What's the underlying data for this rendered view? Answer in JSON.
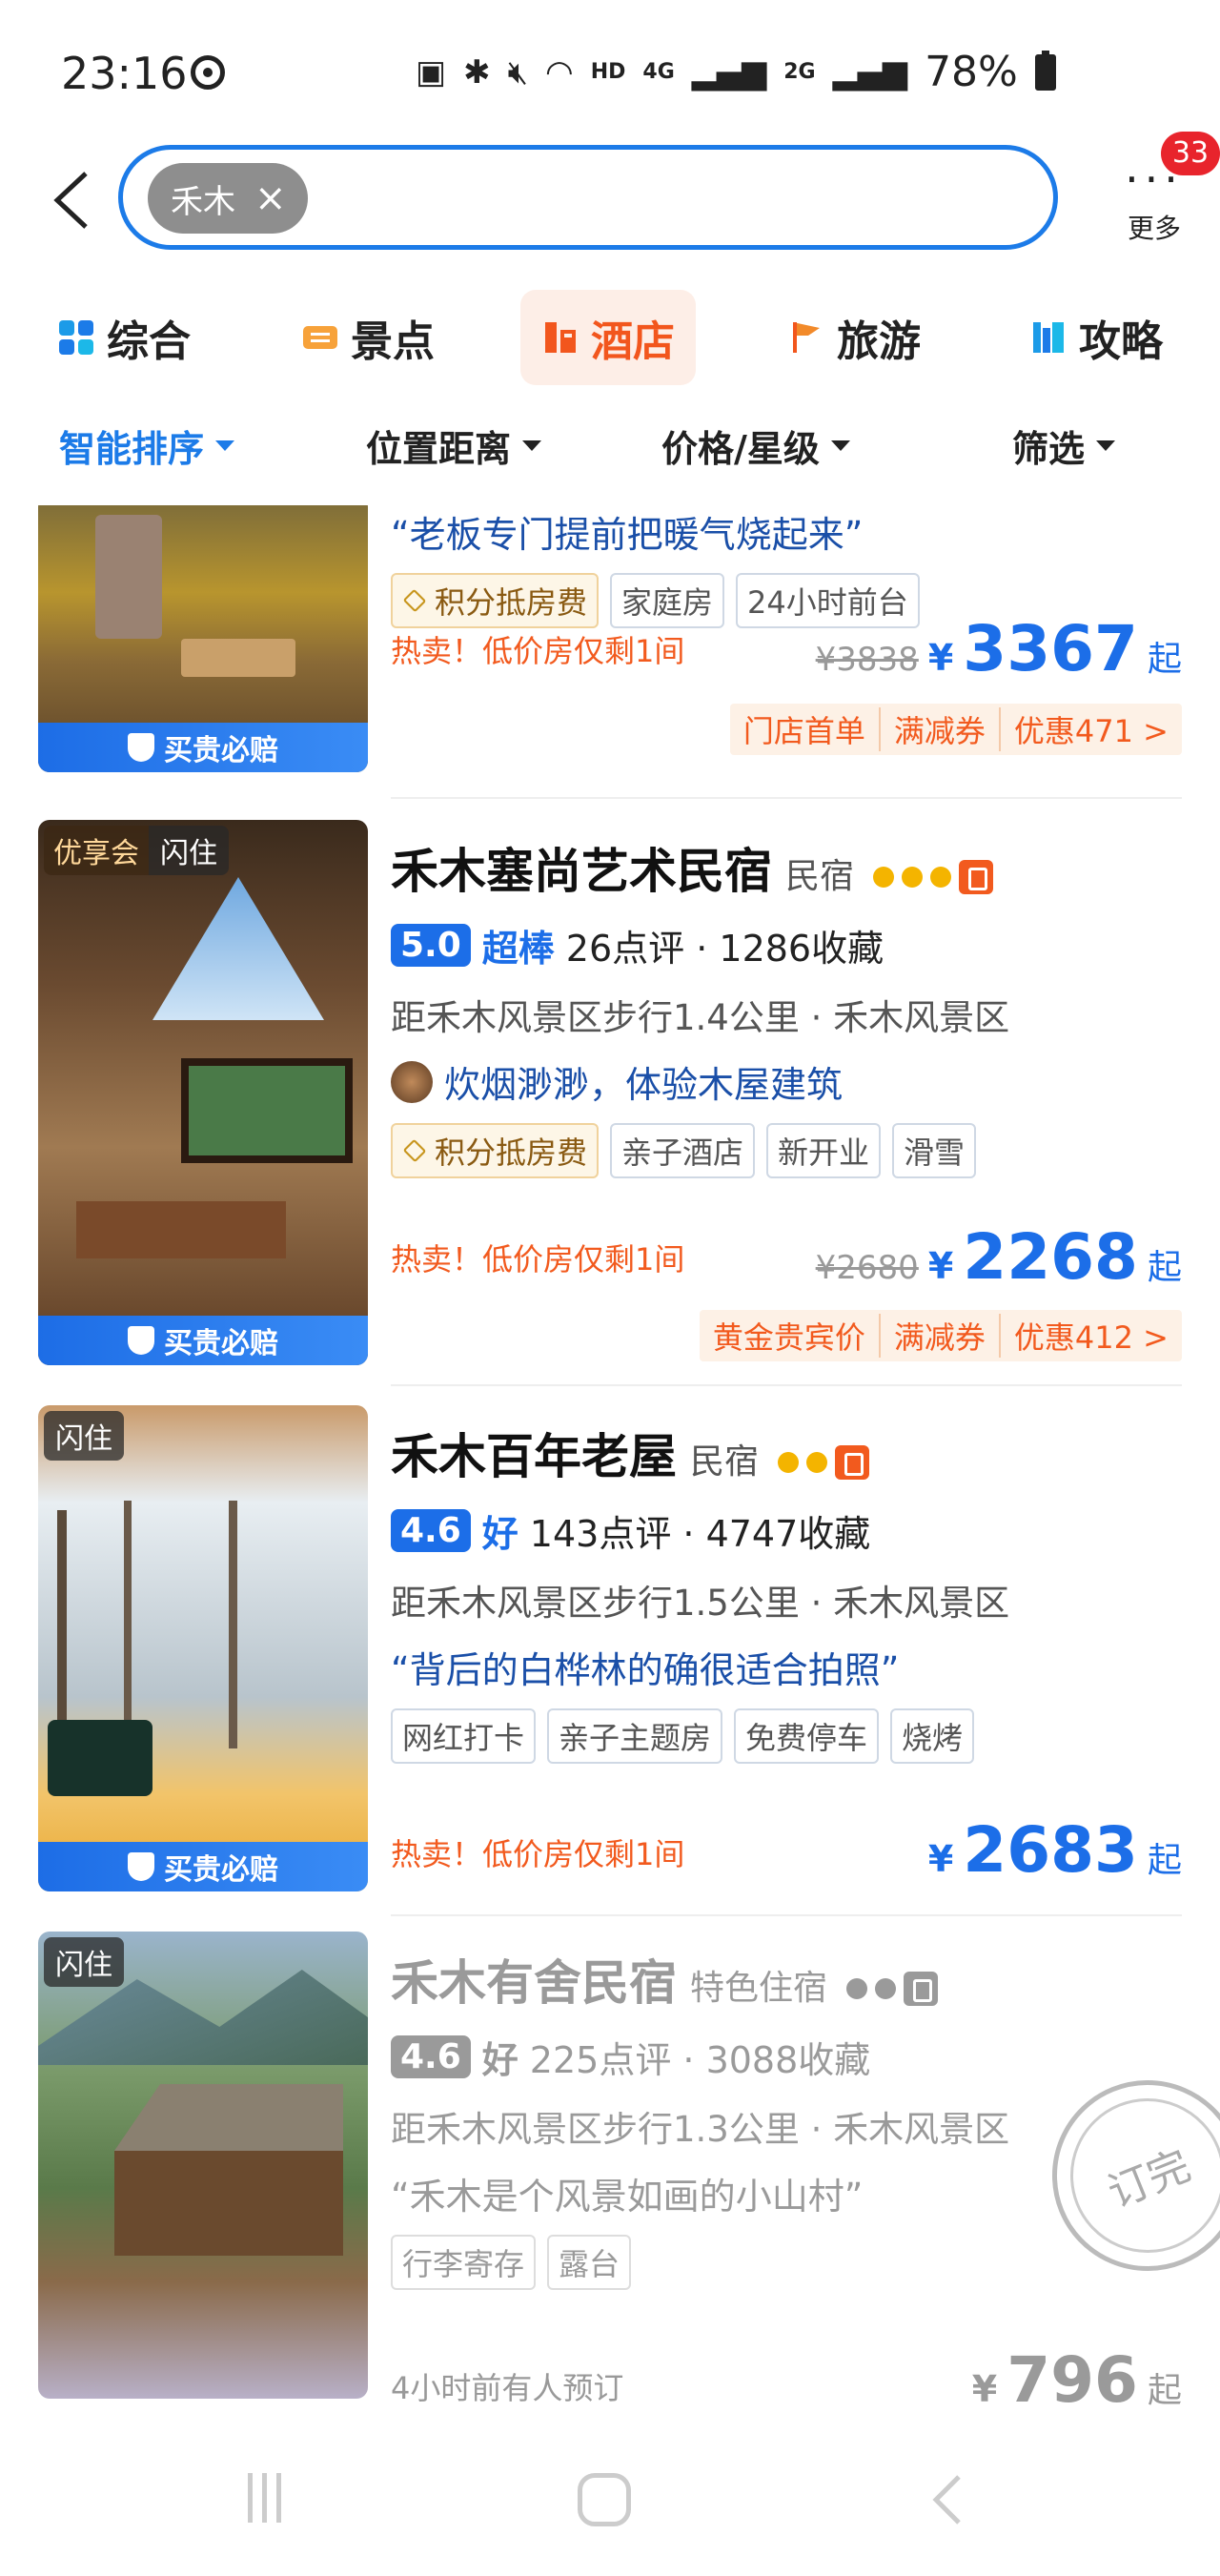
{
  "status_bar": {
    "time": "23:16",
    "net_hd": "HD",
    "net_4g": "4G",
    "net_2g": "2G",
    "battery": "78%",
    "icons": [
      "sync-icon",
      "battery-saver-icon",
      "bluetooth-icon",
      "mute-icon",
      "wifi-icon",
      "signal-icon",
      "battery-icon"
    ]
  },
  "search": {
    "chip_label": "禾木",
    "chip_close": "×",
    "more_label": "更多",
    "more_dots": "···",
    "badge_count": "33"
  },
  "category_tabs": [
    {
      "label": "综合",
      "icon": "grid-icon",
      "active": false
    },
    {
      "label": "景点",
      "icon": "ticket-icon",
      "active": false
    },
    {
      "label": "酒店",
      "icon": "hotel-icon",
      "active": true
    },
    {
      "label": "旅游",
      "icon": "flag-icon",
      "active": false
    },
    {
      "label": "攻略",
      "icon": "book-icon",
      "active": false
    }
  ],
  "sort_bar": [
    {
      "label": "智能排序",
      "active": true
    },
    {
      "label": "位置距离",
      "active": false
    },
    {
      "label": "价格/星级",
      "active": false
    },
    {
      "label": "筛选",
      "active": false
    }
  ],
  "listings": [
    {
      "quote": "“老板专门提前把暖气烧起来”",
      "tags": [
        "积分抵房费",
        "家庭房",
        "24小时前台"
      ],
      "hot_text": "热卖！低价房仅剩1间",
      "old_price": "¥3838",
      "currency": "¥",
      "price": "3367",
      "price_suffix": "起",
      "promos": [
        "门店首单",
        "满减券",
        "优惠471 >"
      ],
      "pay_band": "买贵必赔"
    },
    {
      "photo_tags": [
        "优享会",
        "闪住"
      ],
      "title": "禾木塞尚艺术民宿",
      "type": "民宿",
      "dots": 3,
      "score": "5.0",
      "score_word": "超棒",
      "meta": "26点评 · 1286收藏",
      "location": "距禾木风景区步行1.4公里 · 禾木风景区",
      "quote": "炊烟渺渺，体验木屋建筑",
      "tags": [
        "积分抵房费",
        "亲子酒店",
        "新开业",
        "滑雪"
      ],
      "hot_text": "热卖！低价房仅剩1间",
      "old_price": "¥2680",
      "currency": "¥",
      "price": "2268",
      "price_suffix": "起",
      "promos": [
        "黄金贵宾价",
        "满减券",
        "优惠412 >"
      ],
      "pay_band": "买贵必赔"
    },
    {
      "photo_tags": [
        "闪住"
      ],
      "title": "禾木百年老屋",
      "type": "民宿",
      "dots": 2,
      "score": "4.6",
      "score_word": "好",
      "meta": "143点评 · 4747收藏",
      "location": "距禾木风景区步行1.5公里 · 禾木风景区",
      "quote": "“背后的白桦林的确很适合拍照”",
      "tags": [
        "网红打卡",
        "亲子主题房",
        "免费停车",
        "烧烤"
      ],
      "hot_text": "热卖！低价房仅剩1间",
      "currency": "¥",
      "price": "2683",
      "price_suffix": "起",
      "pay_band": "买贵必赔"
    },
    {
      "photo_tags": [
        "闪住"
      ],
      "title": "禾木有舍民宿",
      "type": "特色住宿",
      "dots": 2,
      "score": "4.6",
      "score_word": "好",
      "meta": "225点评 · 3088收藏",
      "location": "距禾木风景区步行1.3公里 · 禾木风景区",
      "quote": "“禾木是个风景如画的小山村”",
      "tags": [
        "行李寄存",
        "露台"
      ],
      "booked_note": "4小时前有人预订",
      "currency": "¥",
      "price": "796",
      "price_suffix": "起",
      "sold_stamp": "订完"
    }
  ],
  "colors": {
    "accent_blue": "#1c7be8",
    "hotel_orange": "#f2561d",
    "rating_blue": "#1c6ee8",
    "badge_red": "#e8242c"
  }
}
